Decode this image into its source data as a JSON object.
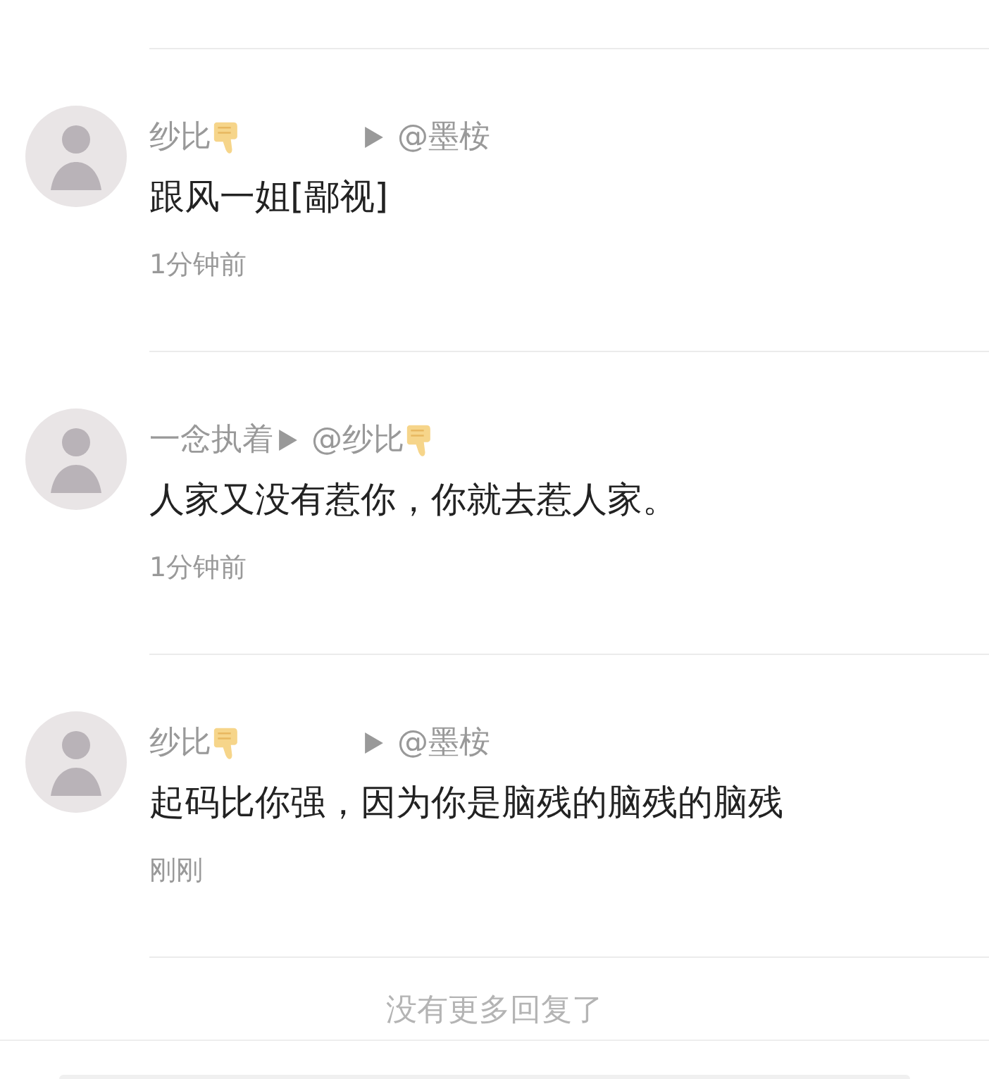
{
  "replies": [
    {
      "author": "纱比",
      "author_thumbs_down": true,
      "target": "@墨桉",
      "target_thumbs_down": false,
      "text": "跟风一姐[鄙视]",
      "time": "1分钟前"
    },
    {
      "author": "一念执着",
      "author_thumbs_down": false,
      "target": "@纱比",
      "target_thumbs_down": true,
      "text": "人家又没有惹你，你就去惹人家。",
      "time": "1分钟前"
    },
    {
      "author": "纱比",
      "author_thumbs_down": true,
      "target": "@墨桉",
      "target_thumbs_down": false,
      "text": "起码比你强，因为你是脑残的脑残的脑残",
      "time": "刚刚"
    }
  ],
  "footer": "没有更多回复了"
}
